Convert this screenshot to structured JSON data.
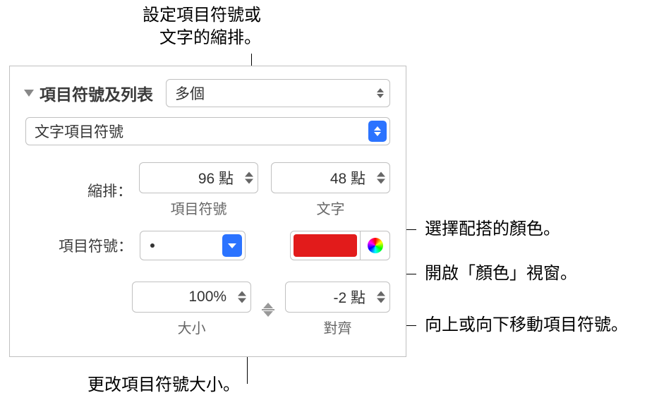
{
  "annotations": {
    "top": "設定項目符號或\n文字的縮排。",
    "color_match": "選擇配搭的顏色。",
    "color_window": "開啟「顏色」視窗。",
    "move_bullet": "向上或向下移動項目符號。",
    "size_change": "更改項目符號大小。"
  },
  "section": {
    "title": "項目符號及列表",
    "preset": "多個",
    "bullet_type": "文字項目符號"
  },
  "indent": {
    "label": "縮排：",
    "bullet_value": "96 點",
    "bullet_sub": "項目符號",
    "text_value": "48 點",
    "text_sub": "文字"
  },
  "bullet": {
    "label": "項目符號："
  },
  "size": {
    "value": "100%",
    "sub": "大小"
  },
  "align": {
    "value": "-2 點",
    "sub": "對齊"
  }
}
